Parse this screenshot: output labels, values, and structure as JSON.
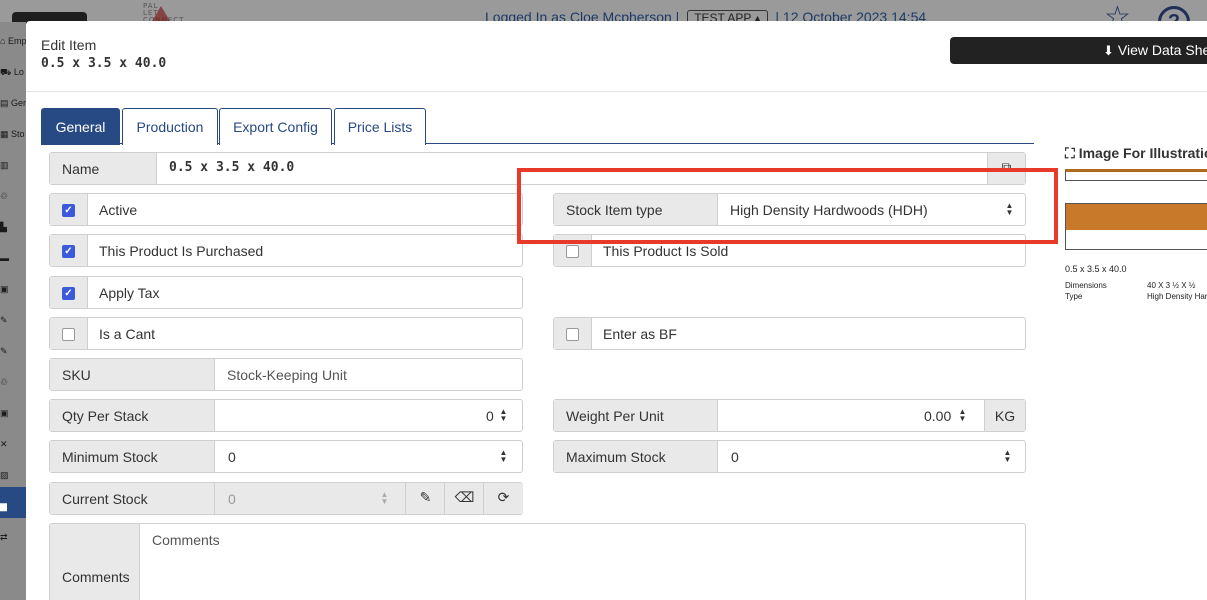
{
  "background": {
    "status_user": "Logged In as Cloe Mcpherson",
    "status_app": "TEST APP",
    "status_datetime": "12 October 2023 14:54",
    "sidebar_items": [
      "Emp",
      "Lo",
      "Ger",
      "Sto",
      "",
      "",
      "",
      "",
      "",
      "",
      "",
      "",
      "",
      "",
      "",
      "",
      "",
      ""
    ]
  },
  "modal": {
    "title": "Edit Item",
    "subtitle": "0.5 x 3.5 x 40.0",
    "view_datasheet_label": "View Data Sheet"
  },
  "tabs": [
    {
      "label": "General",
      "active": true
    },
    {
      "label": "Production",
      "active": false
    },
    {
      "label": "Export Config",
      "active": false
    },
    {
      "label": "Price Lists",
      "active": false
    }
  ],
  "form": {
    "name_label": "Name",
    "name_value": "0.5 x 3.5 x 40.0",
    "active_label": "Active",
    "active_checked": true,
    "stock_item_type_label": "Stock Item type",
    "stock_item_type_value": "High Density Hardwoods (HDH)",
    "purchased_label": "This Product Is Purchased",
    "purchased_checked": true,
    "sold_label": "This Product Is Sold",
    "sold_checked": false,
    "apply_tax_label": "Apply Tax",
    "apply_tax_checked": true,
    "cant_label": "Is a Cant",
    "cant_checked": false,
    "enter_bf_label": "Enter as BF",
    "enter_bf_checked": false,
    "sku_label": "SKU",
    "sku_placeholder": "Stock-Keeping Unit",
    "qty_per_stack_label": "Qty Per Stack",
    "qty_per_stack_value": "0",
    "weight_per_unit_label": "Weight Per Unit",
    "weight_per_unit_value": "0.00",
    "weight_unit": "KG",
    "minimum_stock_label": "Minimum Stock",
    "minimum_stock_value": "0",
    "maximum_stock_label": "Maximum Stock",
    "maximum_stock_value": "0",
    "current_stock_label": "Current Stock",
    "current_stock_value": "0",
    "comments_label": "Comments",
    "comments_placeholder": "Comments"
  },
  "preview": {
    "title": "Image For Illustration",
    "item_label": "0.5 x 3.5 x 40.0",
    "dimensions_key": "Dimensions",
    "dimensions_value": "40 X 3 ½ X ½",
    "type_key": "Type",
    "type_value": "High Density Hardwoods"
  },
  "colors": {
    "accent": "#274a84",
    "checkbox": "#3b5bdb",
    "highlight": "#e8392a",
    "wood": "#c87a2a"
  }
}
